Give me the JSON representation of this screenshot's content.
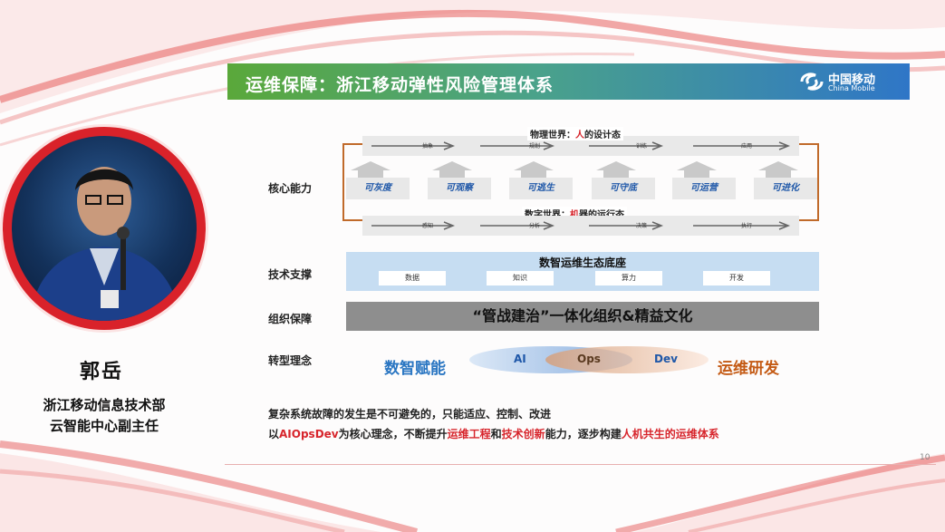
{
  "title": "运维保障：浙江移动弹性风险管理体系",
  "brand": {
    "cn": "中国移动",
    "en": "China Mobile",
    "color": "#1b74c9"
  },
  "speaker": {
    "name": "郭岳",
    "title_line1": "浙江移动信息技术部",
    "title_line2": "云智能中心副主任"
  },
  "rows": {
    "core": "核心能力",
    "tech": "技术支撑",
    "org": "组织保障",
    "trans": "转型理念"
  },
  "physical_world": {
    "prefix": "物理世界：",
    "highlight": "人",
    "suffix": "的设计态",
    "steps": [
      "抽象",
      "规划",
      "训练",
      "应用"
    ]
  },
  "digital_world": {
    "prefix": "数字世界：",
    "highlight": "机",
    "suffix": "器的运行态",
    "steps": [
      "感知",
      "分析",
      "决策",
      "执行"
    ]
  },
  "capabilities": [
    "可灰度",
    "可观察",
    "可逃生",
    "可守底",
    "可运营",
    "可进化"
  ],
  "tech": {
    "title": "数智运维生态底座",
    "items": [
      "数据",
      "知识",
      "算力",
      "开发"
    ]
  },
  "org_text": "“管战建治”一体化组织&精益文化",
  "transform": {
    "left": "数智赋能",
    "ai": "AI",
    "ops": "Ops",
    "dev": "Dev",
    "right": "运维研发"
  },
  "bottom": {
    "line1": "复杂系统故障的发生是不可避免的，只能适应、控制、改进",
    "l2_a": "以",
    "l2_b": "AIOpsDev",
    "l2_c": "为核心理念，不断提升",
    "l2_d": "运维工程",
    "l2_e": "和",
    "l2_f": "技术创新",
    "l2_g": "能力，逐步构建",
    "l2_h": "人机共生的运维体系"
  },
  "page_number": "10",
  "colors": {
    "accent_red": "#d7252c",
    "accent_blue": "#2a76c2",
    "accent_orange": "#c45a14"
  }
}
